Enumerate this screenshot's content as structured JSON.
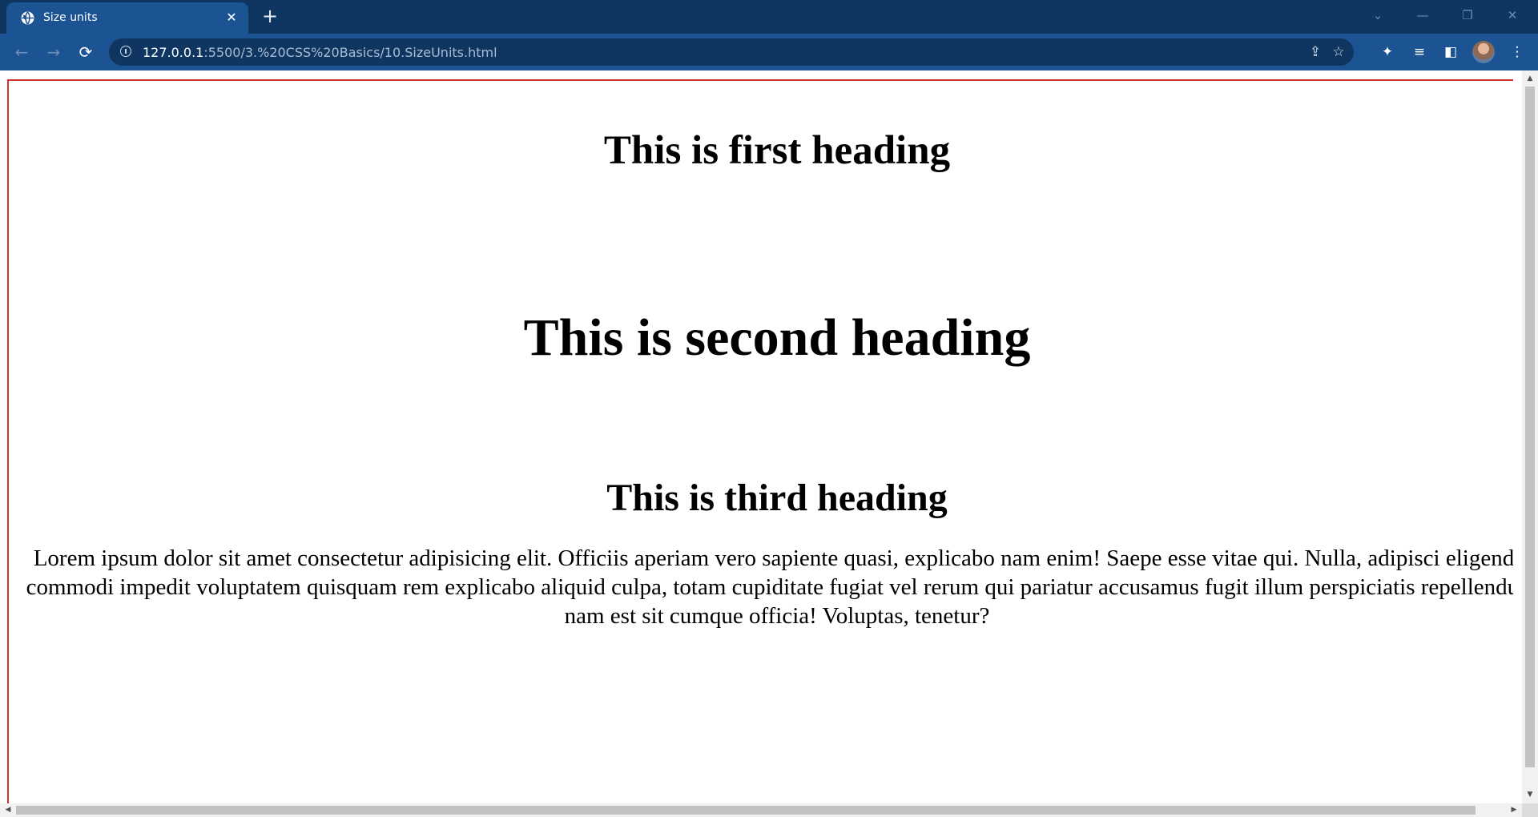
{
  "browser": {
    "tab": {
      "title": "Size units",
      "close_glyph": "✕",
      "favicon": "globe-icon"
    },
    "new_tab_glyph": "+",
    "window_controls": {
      "tab_search": "⌄",
      "minimize": "—",
      "restore": "❐",
      "close": "✕"
    },
    "nav": {
      "back": "←",
      "forward": "→",
      "reload": "⟳"
    },
    "address": {
      "host": "127.0.0.1",
      "path": ":5500/3.%20CSS%20Basics/10.SizeUnits.html"
    },
    "omnibox_icons": {
      "share": "⇪",
      "bookmark": "☆"
    },
    "toolbar_icons": {
      "extensions": "✦",
      "media": "≡",
      "side_panel": "◧",
      "menu": "⋮"
    }
  },
  "page": {
    "heading_first": "This is first heading",
    "heading_second": "This is second heading",
    "heading_third": "This is third heading",
    "paragraph": "Lorem ipsum dolor sit amet consectetur adipisicing elit. Officiis aperiam vero sapiente quasi, explicabo nam enim! Saepe esse vitae qui. Nulla, adipisci eligendi commodi impedit voluptatem quisquam rem explicabo aliquid culpa, totam cupiditate fugiat vel rerum qui pariatur accusamus fugit illum perspiciatis repellendus nam est sit cumque officia! Voluptas, tenetur?"
  },
  "scrollbars": {
    "up": "▲",
    "down": "▼",
    "left": "◀",
    "right": "▶"
  },
  "colors": {
    "tabbar": "#0e3660",
    "toolbar": "#1c5393",
    "page_border": "#cc3333"
  }
}
